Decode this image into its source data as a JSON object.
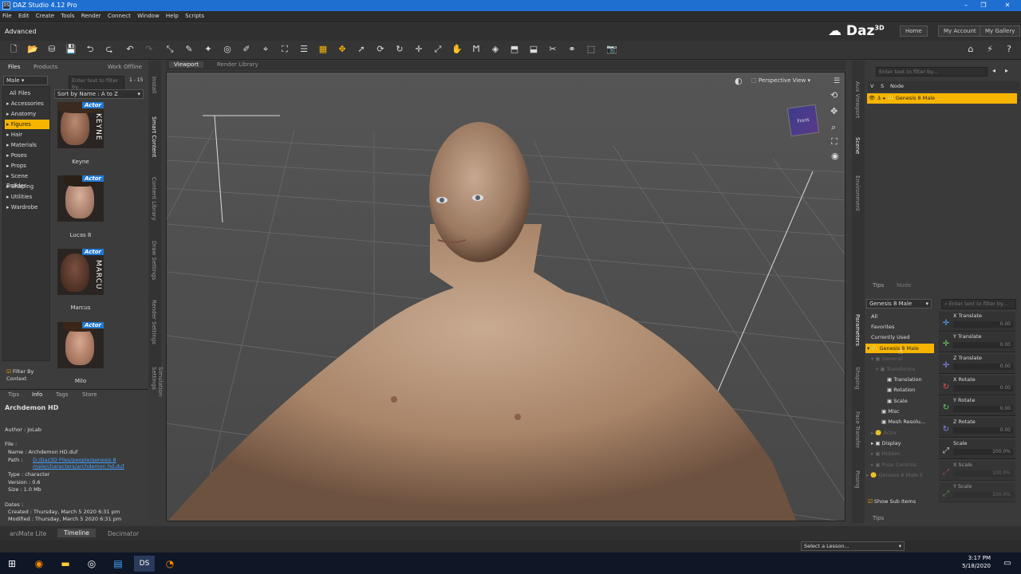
{
  "window": {
    "title": "DAZ Studio 4.12 Pro",
    "app_icon": "DS"
  },
  "menu": [
    "File",
    "Edit",
    "Create",
    "Tools",
    "Render",
    "Connect",
    "Window",
    "Help",
    "Scripts"
  ],
  "layout_label": "Advanced",
  "brand": {
    "logo": "Daz",
    "sup": "3D",
    "nav": [
      "Home",
      "My Account",
      "My Gallery"
    ]
  },
  "left": {
    "tabs": [
      "Files",
      "Products",
      "Work Offline"
    ],
    "filter_dropdown": "Male",
    "filter_placeholder": "Enter text to filter by...",
    "count": "1 - 15",
    "sort": "Sort by Name : A to Z",
    "categories": [
      "All Files",
      "Accessories",
      "Anatomy",
      "Figures",
      "Hair",
      "Materials",
      "Poses",
      "Props",
      "Scene Builder",
      "Shaping",
      "Utilities",
      "Wardrobe"
    ],
    "selected_category": "Figures",
    "items": [
      {
        "name": "Keyne",
        "badge": "Actor",
        "tag": "KEYNE"
      },
      {
        "name": "Lucas 8",
        "badge": "Actor",
        "tag": ""
      },
      {
        "name": "Marcus",
        "badge": "Actor",
        "tag": "MARCU"
      },
      {
        "name": "Milo",
        "badge": "Actor",
        "tag": ""
      }
    ],
    "filter_context": "Filter By Context"
  },
  "left_vtabs": [
    "Install",
    "Smart Content",
    "Content Library",
    "Draw Settings",
    "Render Settings",
    "Simulation Settings"
  ],
  "info": {
    "tabs": [
      "Tips",
      "Info",
      "Tags",
      "Store"
    ],
    "title": "Archdemon HD",
    "author": "Author : JoLab",
    "file_label": "File :",
    "name": "Name    :  Archdemon HD.duf",
    "path_label": "Path    :",
    "path_value": "D:/Daz3D Files/people/genesis 8 male/characters/archdemon hd.duf",
    "type": "Type    :  character",
    "version": "Version :  0.6",
    "size": "Size    :  1.0 Mb",
    "dates_label": "Dates :",
    "created": "Created  :  Thursday, March 5 2020 6:31 pm",
    "modified": "Modified :  Thursday, March 5 2020 6:31 pm"
  },
  "viewport": {
    "tabs": [
      "Viewport",
      "Render Library"
    ],
    "camera": "Perspective View",
    "cube_face": "Front"
  },
  "scene": {
    "filter_placeholder": "Enter text to filter by...",
    "cols": [
      "V",
      "S",
      "Node"
    ],
    "node": "Genesis 8 Male",
    "bottom_tabs": [
      "Tips",
      "Node"
    ]
  },
  "right_vtabs": [
    "Aux Viewport",
    "Scene",
    "Environment",
    "Parameters",
    "Shaping",
    "Face Transfer",
    "Posing"
  ],
  "parameters": {
    "figure_dropdown": "Genesis 8 Male",
    "filter_placeholder": "Enter text to filter by...",
    "tree": [
      "All",
      "Favorites",
      "Currently Used",
      "Genesis 8 Male",
      "General",
      "Transforms",
      "Translation",
      "Rotation",
      "Scale",
      "Misc",
      "Mesh Resolu...",
      "Actor",
      "Display",
      "Hidden",
      "Pose Controls",
      "Genesis 8 Male E"
    ],
    "sliders": [
      {
        "label": "X Translate",
        "value": "0.00"
      },
      {
        "label": "Y Translate",
        "value": "0.00"
      },
      {
        "label": "Z Translate",
        "value": "0.00"
      },
      {
        "label": "X Rotate",
        "value": "0.00"
      },
      {
        "label": "Y Rotate",
        "value": "0.00"
      },
      {
        "label": "Z Rotate",
        "value": "0.00"
      },
      {
        "label": "Scale",
        "value": "100.0%"
      },
      {
        "label": "X Scale",
        "value": "100.0%"
      },
      {
        "label": "Y Scale",
        "value": "100.0%"
      }
    ],
    "show_sub": "Show Sub Items",
    "bottom_tab": "Tips"
  },
  "bottom_tabs": [
    "aniMate Lite",
    "Timeline",
    "Decimator"
  ],
  "lesson": "Select a Lesson...",
  "taskbar": {
    "time": "3:17 PM",
    "date": "5/18/2020"
  },
  "colors": {
    "accent": "#f7b500",
    "title": "#1f6fd1",
    "link": "#4aa3ff"
  }
}
